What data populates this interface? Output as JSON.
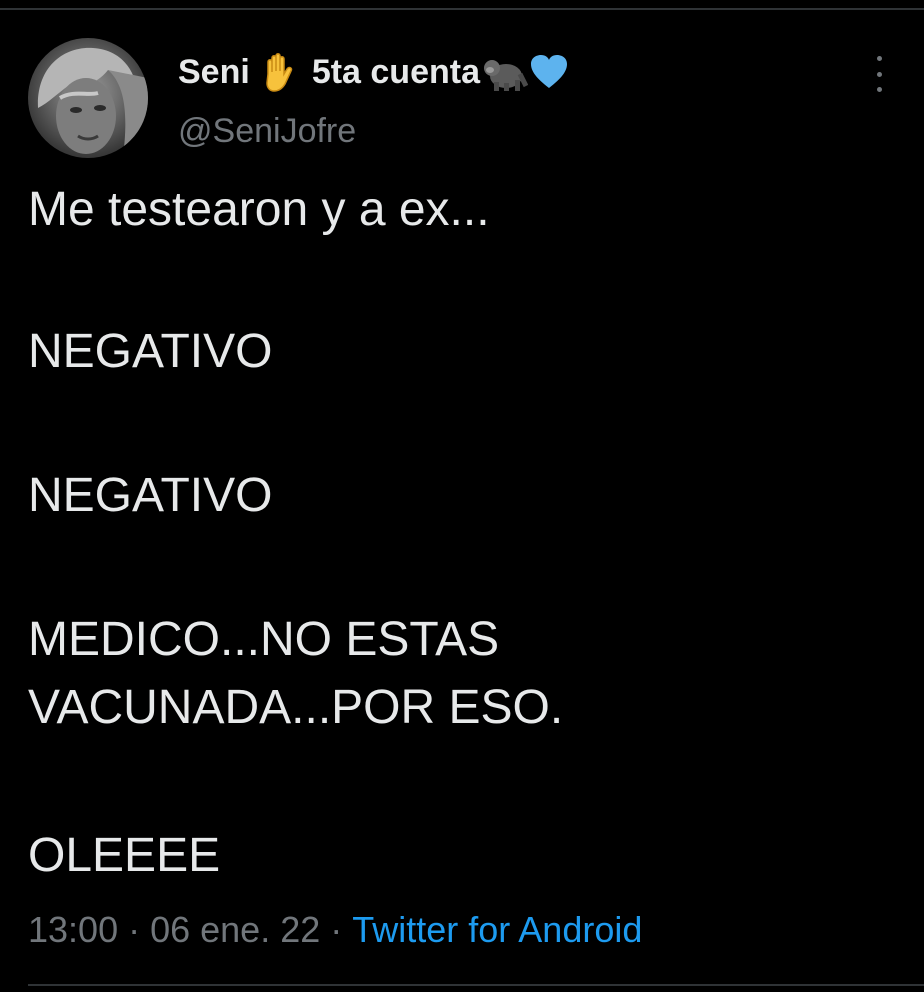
{
  "tweet": {
    "author": {
      "name_before_emoji": "Seni",
      "name_after_emoji": "5ta cuenta",
      "handle": "@SeniJofre",
      "emojis": [
        "raised-hand-icon",
        "gorilla-icon",
        "blue-heart-icon"
      ]
    },
    "lines": [
      "Me testearon y a ex...",
      "NEGATIVO",
      "NEGATIVO",
      "MEDICO...NO ESTAS",
      "VACUNADA...POR ESO.",
      "OLEEEE"
    ],
    "time": "13:00",
    "date": "06 ene. 22",
    "separator": "·",
    "source": "Twitter for Android"
  },
  "colors": {
    "background": "#000000",
    "text": "#e7e9ea",
    "secondary": "#71767b",
    "link": "#1d9bf0",
    "divider": "#2f3336"
  }
}
